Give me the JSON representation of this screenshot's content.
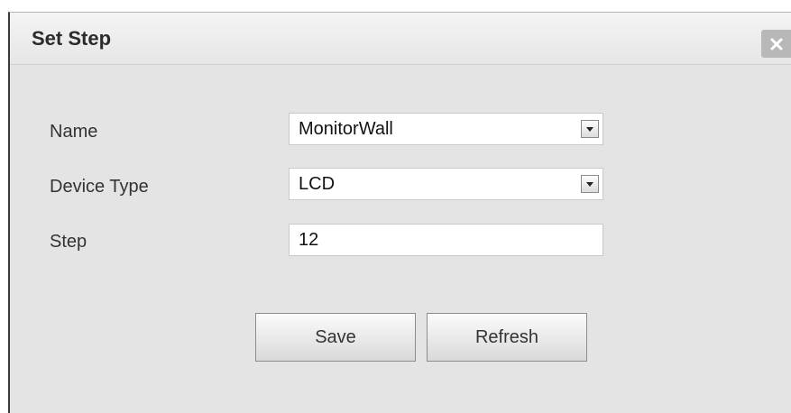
{
  "dialog": {
    "title": "Set Step",
    "close_icon": "close-icon"
  },
  "form": {
    "name": {
      "label": "Name",
      "value": "MonitorWall"
    },
    "device_type": {
      "label": "Device Type",
      "value": "LCD"
    },
    "step": {
      "label": "Step",
      "value": "12"
    }
  },
  "buttons": {
    "save_label": "Save",
    "refresh_label": "Refresh"
  },
  "icons": {
    "dropdown": "chevron-down-icon"
  }
}
